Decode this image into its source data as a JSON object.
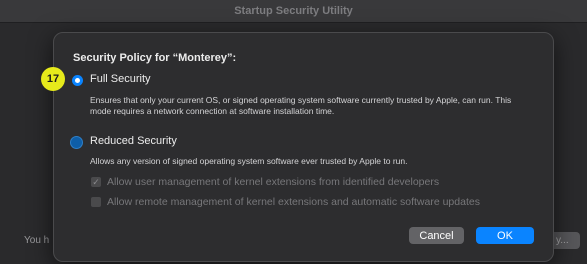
{
  "window": {
    "title": "Startup Security Utility",
    "background_text": "You h",
    "background_button": "y..."
  },
  "sheet": {
    "heading": "Security Policy for “Monterey”:",
    "options": [
      {
        "label": "Full Security",
        "selected": true,
        "description": "Ensures that only your current OS, or signed operating system software currently trusted by Apple, can run. This mode requires a network connection at software installation time."
      },
      {
        "label": "Reduced Security",
        "selected": false,
        "description": "Allows any version of signed operating system software ever trusted by Apple to run."
      }
    ],
    "checkboxes": [
      {
        "label": "Allow user management of kernel extensions from identified developers",
        "checked": true,
        "enabled": false
      },
      {
        "label": "Allow remote management of kernel extensions and automatic software updates",
        "checked": false,
        "enabled": false
      }
    ],
    "buttons": {
      "cancel": "Cancel",
      "ok": "OK"
    }
  },
  "step_badge": "17",
  "colors": {
    "accent": "#0a84ff",
    "badge": "#e6ea1b",
    "sheet_background": "#2d2d2f"
  }
}
